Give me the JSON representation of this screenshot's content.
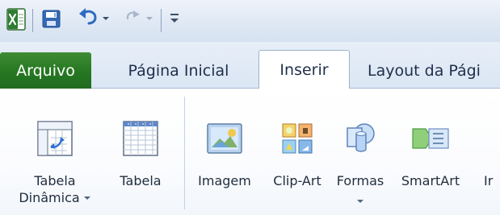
{
  "quick_access": {
    "app_icon": "excel-icon",
    "save_icon": "save-icon",
    "undo_icon": "undo-icon",
    "undo_dropdown_icon": "chevron-down-icon",
    "redo_icon": "redo-icon",
    "redo_dropdown_icon": "chevron-down-icon",
    "customize_icon": "customize-toolbar-icon"
  },
  "tabs": [
    {
      "label": "Arquivo",
      "selected": false,
      "accent": "#2e7d32"
    },
    {
      "label": "Página Inicial",
      "selected": false
    },
    {
      "label": "Inserir",
      "selected": true
    },
    {
      "label": "Layout da Pági",
      "selected": false
    }
  ],
  "ribbon": {
    "commands": [
      {
        "label_line1": "Tabela",
        "label_line2": "Dinâmica",
        "icon": "pivot-table-icon",
        "has_dropdown": true
      },
      {
        "label": "Tabela",
        "icon": "table-icon",
        "has_dropdown": false
      },
      {
        "label": "Imagem",
        "icon": "picture-icon",
        "has_dropdown": false
      },
      {
        "label": "Clip-Art",
        "icon": "clip-art-icon",
        "has_dropdown": false
      },
      {
        "label": "Formas",
        "icon": "shapes-icon",
        "has_dropdown": true
      },
      {
        "label": "SmartArt",
        "icon": "smartart-icon",
        "has_dropdown": false
      },
      {
        "label": "Ir",
        "icon": "",
        "has_dropdown": false
      }
    ]
  },
  "colors": {
    "ribbon_blue": "#dbe6f4",
    "file_tab_green": "#267722",
    "text_dark": "#1f2d3d",
    "border_blue": "#9fb2ca"
  }
}
